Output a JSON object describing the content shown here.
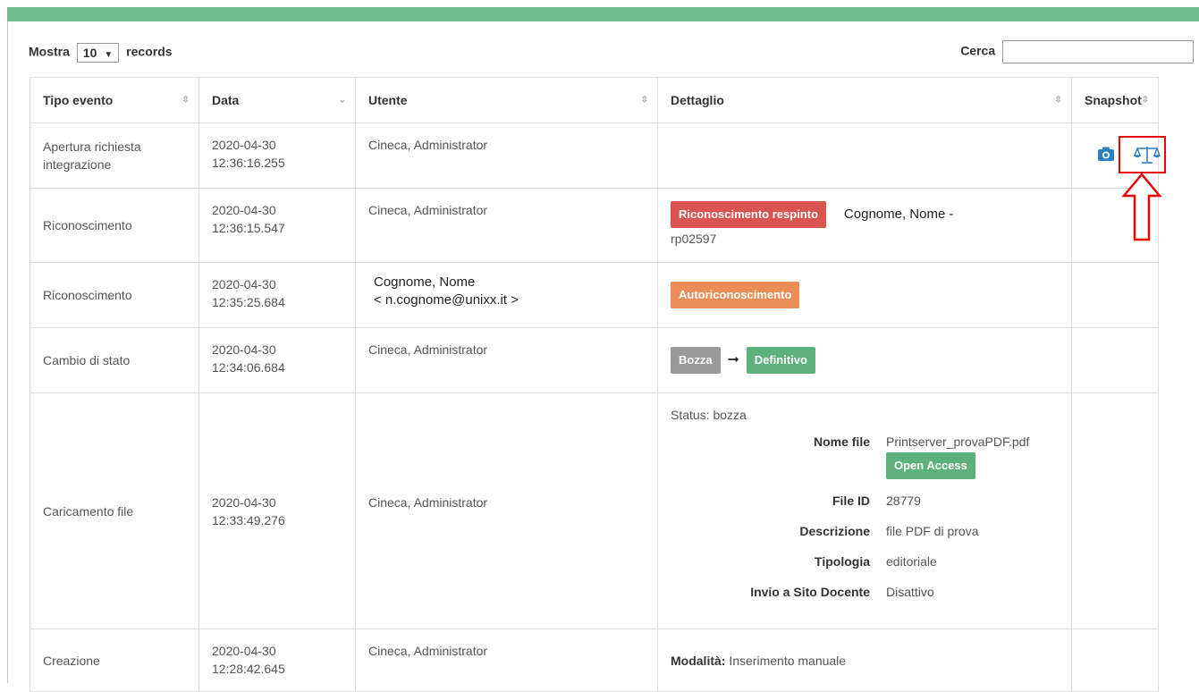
{
  "controls": {
    "show_label": "Mostra",
    "show_value": "10",
    "records_label": "records",
    "search_label": "Cerca",
    "search_value": ""
  },
  "table": {
    "headers": [
      "Tipo evento",
      "Data",
      "Utente",
      "Dettaglio",
      "Snapshot"
    ],
    "rows": [
      {
        "tipo": "Apertura richiesta integrazione",
        "date": "2020-04-30",
        "time": "12:36:16.255",
        "utente": "Cineca, Administrator"
      },
      {
        "tipo": "Riconoscimento",
        "date": "2020-04-30",
        "time": "12:36:15.547",
        "utente": "Cineca, Administrator",
        "badge": "Riconoscimento respinto",
        "name": "Cognome, Nome   -",
        "code": "rp02597"
      },
      {
        "tipo": "Riconoscimento",
        "date": "2020-04-30",
        "time": "12:35:25.684",
        "utente_name": "Cognome, Nome",
        "utente_email": "< n.cognome@unixx.it  >",
        "badge": "Autoriconoscimento"
      },
      {
        "tipo": "Cambio di stato",
        "date": "2020-04-30",
        "time": "12:34:06.684",
        "utente": "Cineca, Administrator",
        "from": "Bozza",
        "to": "Definitivo"
      },
      {
        "tipo": "Caricamento file",
        "date": "2020-04-30",
        "time": "12:33:49.276",
        "utente": "Cineca, Administrator",
        "status": "Status: bozza",
        "fields": [
          {
            "k": "Nome file",
            "v": "Printserver_provaPDF.pdf"
          },
          {
            "k": "File ID",
            "v": "28779"
          },
          {
            "k": "Descrizione",
            "v": "file PDF di prova"
          },
          {
            "k": "Tipologia",
            "v": "editoriale"
          },
          {
            "k": "Invio a Sito Docente",
            "v": "Disattivo"
          }
        ],
        "open_access": "Open Access"
      },
      {
        "tipo": "Creazione",
        "date": "2020-04-30",
        "time": "12:28:42.645",
        "utente": "Cineca, Administrator",
        "mod_label": "Modalità:",
        "mod_value": "Inserimento manuale"
      }
    ]
  },
  "colors": {
    "accent": "#6ebd8b",
    "danger": "#d9534f",
    "warning": "#ec8c57",
    "success": "#5cb27a",
    "icon": "#2a7fc1",
    "highlight": "#e00000"
  },
  "icons": [
    "camera-icon",
    "scale-icon",
    "arrow-up-icon",
    "sort-icon"
  ]
}
